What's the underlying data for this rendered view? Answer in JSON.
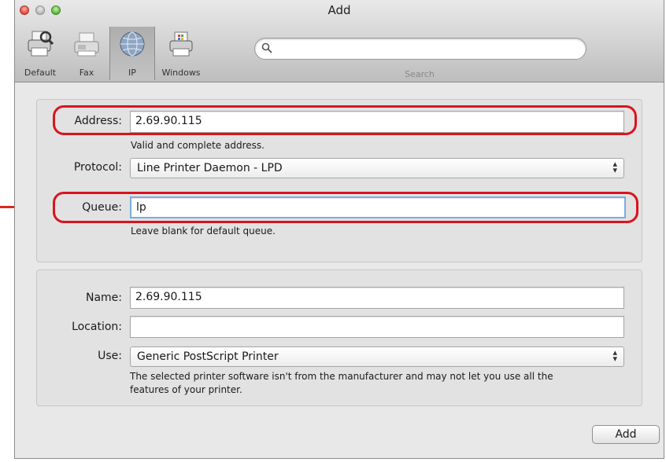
{
  "window": {
    "title": "Add"
  },
  "toolbar": {
    "items": [
      {
        "label": "Default",
        "icon": "printer-search-icon"
      },
      {
        "label": "Fax",
        "icon": "fax-icon"
      },
      {
        "label": "IP",
        "icon": "globe-icon",
        "selected": true
      },
      {
        "label": "Windows",
        "icon": "windows-printer-icon"
      }
    ],
    "search_caption": "Search",
    "search_value": ""
  },
  "connection": {
    "address_label": "Address:",
    "address_value": "2.69.90.115",
    "address_hint": "Valid and complete address.",
    "protocol_label": "Protocol:",
    "protocol_value": "Line Printer Daemon - LPD",
    "queue_label": "Queue:",
    "queue_value": "lp",
    "queue_hint": "Leave blank for default queue."
  },
  "details": {
    "name_label": "Name:",
    "name_value": "2.69.90.115",
    "location_label": "Location:",
    "location_value": "",
    "use_label": "Use:",
    "use_value": "Generic PostScript Printer",
    "use_hint_line1": "The selected printer software isn't from the manufacturer and may not let you use all the",
    "use_hint_line2": "features of your printer."
  },
  "footer": {
    "add_label": "Add"
  },
  "colors": {
    "highlight": "#d9141e",
    "arrow": "#e0261d",
    "focus": "#7aaee0"
  }
}
